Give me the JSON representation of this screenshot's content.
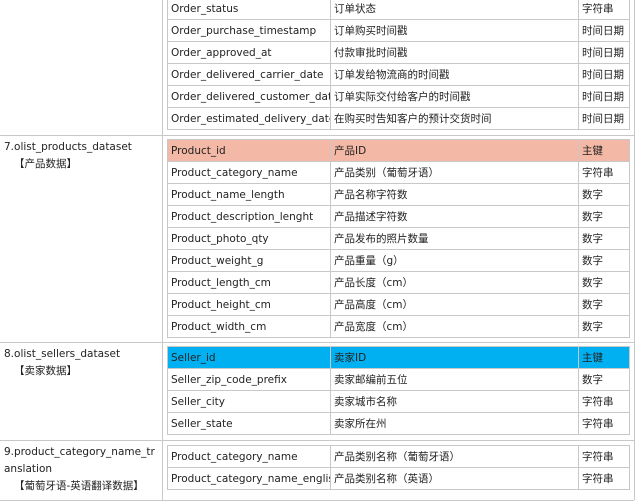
{
  "sections": [
    {
      "title": "",
      "subtitle": "",
      "header_color": null,
      "rows": [
        [
          "Order_status",
          "订单状态",
          "字符串"
        ],
        [
          "Order_purchase_timestamp",
          "订单购买时间戳",
          "时间日期"
        ],
        [
          "Order_approved_at",
          "付款审批时间戳",
          "时间日期"
        ],
        [
          "Order_delivered_carrier_date",
          "订单发给物流商的时间戳",
          "时间日期"
        ],
        [
          "Order_delivered_customer_date",
          "订单实际交付给客户的时间戳",
          "时间日期"
        ],
        [
          "Order_estimated_delivery_date",
          "在购买时告知客户的预计交货时间",
          "时间日期"
        ]
      ]
    },
    {
      "title": "7.olist_products_dataset",
      "subtitle": "【产品数据】",
      "header_color": "#f4b8a6",
      "rows": [
        [
          "Product_id",
          "产品ID",
          "主键"
        ],
        [
          "Product_category_name",
          "产品类别（葡萄牙语）",
          "字符串"
        ],
        [
          "Product_name_length",
          "产品名称字符数",
          "数字"
        ],
        [
          "Product_description_lenght",
          "产品描述字符数",
          "数字"
        ],
        [
          "Product_photo_qty",
          "产品发布的照片数量",
          "数字"
        ],
        [
          "Product_weight_g",
          "产品重量（g）",
          "数字"
        ],
        [
          "Product_length_cm",
          "产品长度（cm）",
          "数字"
        ],
        [
          "Product_height_cm",
          "产品高度（cm）",
          "数字"
        ],
        [
          "Product_width_cm",
          "产品宽度（cm）",
          "数字"
        ]
      ]
    },
    {
      "title": "8.olist_sellers_dataset",
      "subtitle": "【卖家数据】",
      "header_color": "#00b0f0",
      "rows": [
        [
          "Seller_id",
          "卖家ID",
          "主键"
        ],
        [
          "Seller_zip_code_prefix",
          "卖家邮编前五位",
          "数字"
        ],
        [
          "Seller_city",
          "卖家城市名称",
          "字符串"
        ],
        [
          "Seller_state",
          "卖家所在州",
          "字符串"
        ]
      ]
    },
    {
      "title": "9.product_category_name_translation",
      "subtitle": "【葡萄牙语-英语翻译数据】",
      "header_color": null,
      "rows": [
        [
          "Product_category_name",
          "产品类别名称（葡萄牙语）",
          "字符串"
        ],
        [
          "Product_category_name_english",
          "产品类别名称（英语）",
          "字符串"
        ]
      ]
    }
  ]
}
